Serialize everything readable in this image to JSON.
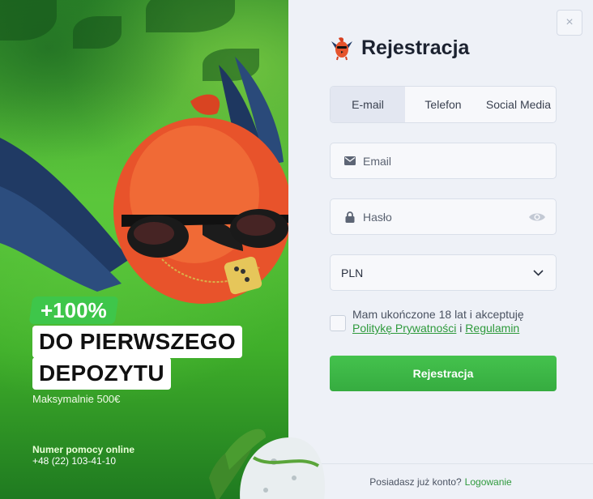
{
  "promo": {
    "badge": "+100%",
    "line1": "DO PIERWSZEGO",
    "line2": "DEPOZYTU",
    "max": "Maksymalnie 500€",
    "help_label": "Numer pomocy online",
    "help_phone": "+48 (22) 103-41-10"
  },
  "form": {
    "close_label": "×",
    "title": "Rejestracja",
    "tabs": [
      {
        "label": "E-mail",
        "active": true
      },
      {
        "label": "Telefon",
        "active": false
      },
      {
        "label": "Social Media",
        "active": false
      }
    ],
    "email_placeholder": "Email",
    "password_placeholder": "Hasło",
    "currency": "PLN",
    "terms_text": "Mam ukończone 18 lat i akceptuję",
    "privacy_link": "Politykę Prywatności",
    "terms_and": "i",
    "rules_link": "Regulamin",
    "submit_label": "Rejestracja"
  },
  "footer": {
    "question": "Posiadasz już konto?",
    "login_link": "Logowanie"
  },
  "colors": {
    "accent_green": "#3cb846",
    "panel_bg": "#eef1f7",
    "link_green": "#2e9a3c"
  },
  "icons": [
    "bird-logo-icon",
    "envelope-icon",
    "lock-icon",
    "eye-icon",
    "chevron-down-icon",
    "close-icon"
  ]
}
